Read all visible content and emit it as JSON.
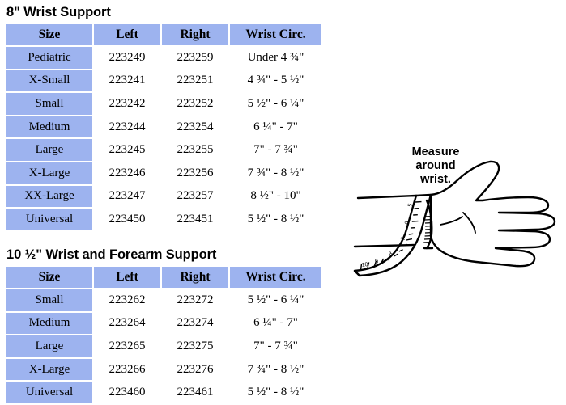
{
  "sections": [
    {
      "title": "8\" Wrist Support",
      "table": {
        "headers": [
          "Size",
          "Left",
          "Right",
          "Wrist Circ."
        ],
        "rows": [
          [
            "Pediatric",
            "223249",
            "223259",
            "Under 4 ¾\""
          ],
          [
            "X-Small",
            "223241",
            "223251",
            "4 ¾\" - 5 ½\""
          ],
          [
            "Small",
            "223242",
            "223252",
            "5 ½\" - 6 ¼\""
          ],
          [
            "Medium",
            "223244",
            "223254",
            "6 ¼\" - 7\""
          ],
          [
            "Large",
            "223245",
            "223255",
            "7\" - 7 ¾\""
          ],
          [
            "X-Large",
            "223246",
            "223256",
            "7 ¾\" - 8 ½\""
          ],
          [
            "XX-Large",
            "223247",
            "223257",
            "8 ½\" - 10\""
          ],
          [
            "Universal",
            "223450",
            "223451",
            "5 ½\" - 8 ½\""
          ]
        ]
      }
    },
    {
      "title": "10 ½\" Wrist and Forearm Support",
      "table": {
        "headers": [
          "Size",
          "Left",
          "Right",
          "Wrist Circ."
        ],
        "rows": [
          [
            "Small",
            "223262",
            "223272",
            "5 ½\" - 6 ¼\""
          ],
          [
            "Medium",
            "223264",
            "223274",
            "6 ¼\" - 7\""
          ],
          [
            "Large",
            "223265",
            "223275",
            "7\" - 7 ¾\""
          ],
          [
            "X-Large",
            "223266",
            "223276",
            "7 ¾\" - 8 ½\""
          ],
          [
            "Universal",
            "223460",
            "223461",
            "5 ½\" - 8 ½\""
          ]
        ]
      }
    }
  ],
  "illustration": {
    "caption_lines": [
      "Measure",
      "around",
      "wrist."
    ],
    "icon": "hand-with-tape-measure-illustration"
  },
  "colors": {
    "header_blue": "#9db3ef",
    "size_column_blue": "#9db3ef",
    "cell_white": "#ffffff",
    "text_black": "#000000",
    "page_background": "#ffffff"
  }
}
